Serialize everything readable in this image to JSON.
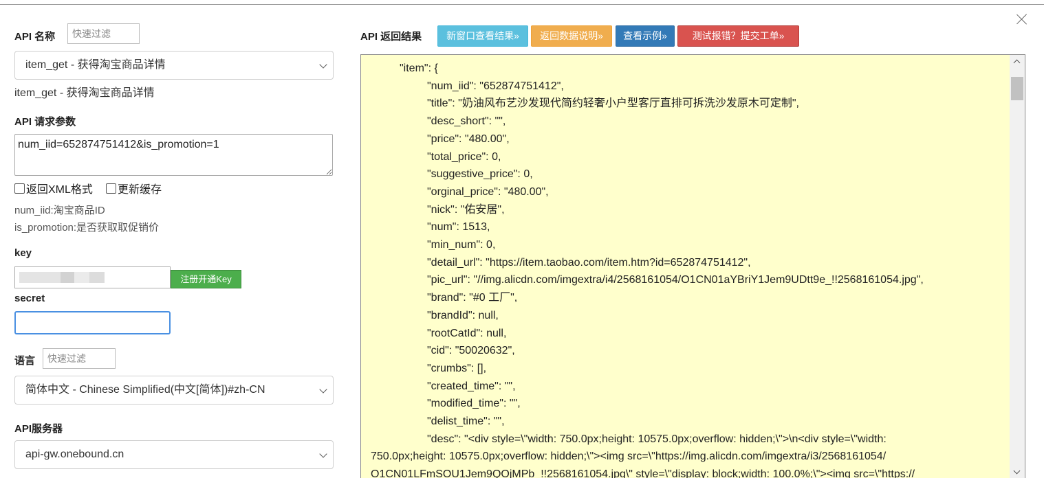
{
  "left": {
    "api_name_label": "API 名称",
    "api_filter_placeholder": "快速过滤",
    "api_selected": "item_get - 获得淘宝商品详情",
    "api_desc": "item_get - 获得淘宝商品详情",
    "params_label": "API 请求参数",
    "params_value": "num_iid=652874751412&is_promotion=1",
    "xml_checkbox": "返回XML格式",
    "cache_checkbox": "更新缓存",
    "hint1": "num_iid:淘宝商品ID",
    "hint2": "is_promotion:是否获取取促销价",
    "key_label": "key",
    "register_button": "注册开通Key",
    "secret_label": "secret",
    "lang_label": "语言",
    "lang_filter_placeholder": "快速过滤",
    "lang_selected": "简体中文 - Chinese Simplified(中文[简体])#zh-CN",
    "server_label": "API服务器",
    "server_selected": "api-gw.onebound.cn"
  },
  "right": {
    "result_label": "API 返回结果",
    "btn_new_window": "新窗口查看结果»",
    "btn_return_desc": "返回数据说明»",
    "btn_example": "查看示例»",
    "btn_report": "测试报错？提交工单»",
    "code_lines": [
      {
        "indent": 2,
        "text": "\"item\": {"
      },
      {
        "indent": 3,
        "text": "\"num_iid\": \"652874751412\","
      },
      {
        "indent": 3,
        "text": "\"title\": \"奶油风布艺沙发现代简约轻奢小户型客厅直排可拆洗沙发原木可定制\","
      },
      {
        "indent": 3,
        "text": "\"desc_short\": \"\","
      },
      {
        "indent": 3,
        "text": "\"price\": \"480.00\","
      },
      {
        "indent": 3,
        "text": "\"total_price\": 0,"
      },
      {
        "indent": 3,
        "text": "\"suggestive_price\": 0,"
      },
      {
        "indent": 3,
        "text": "\"orginal_price\": \"480.00\","
      },
      {
        "indent": 3,
        "text": "\"nick\": \"佑安居\","
      },
      {
        "indent": 3,
        "text": "\"num\": 1513,"
      },
      {
        "indent": 3,
        "text": "\"min_num\": 0,"
      },
      {
        "indent": 3,
        "text": "\"detail_url\": \"https://item.taobao.com/item.htm?id=652874751412\","
      },
      {
        "indent": 3,
        "text": "\"pic_url\": \"//img.alicdn.com/imgextra/i4/2568161054/O1CN01aYBriY1Jem9UDtt9e_!!2568161054.jpg\","
      },
      {
        "indent": 3,
        "text": "\"brand\": \"#0 工厂\","
      },
      {
        "indent": 3,
        "text": "\"brandId\": null,"
      },
      {
        "indent": 3,
        "text": "\"rootCatId\": null,"
      },
      {
        "indent": 3,
        "text": "\"cid\": \"50020632\","
      },
      {
        "indent": 3,
        "text": "\"crumbs\": [],"
      },
      {
        "indent": 3,
        "text": "\"created_time\": \"\","
      },
      {
        "indent": 3,
        "text": "\"modified_time\": \"\","
      },
      {
        "indent": 3,
        "text": "\"delist_time\": \"\","
      }
    ],
    "desc_first": "\"desc\": \"<div style=\\\"width: 750.0px;height: 10575.0px;overflow: hidden;\\\">\\n<div style=\\\"width:",
    "desc_wrap": [
      "750.0px;height: 10575.0px;overflow: hidden;\\\"><img src=\\\"https://img.alicdn.com/imgextra/i3/2568161054/",
      "O1CN01LFmSOU1Jem9QOjMPb_!!2568161054.jpg\\\" style=\\\"display: block;width: 100.0%;\\\"><img src=\\\"https://"
    ]
  }
}
